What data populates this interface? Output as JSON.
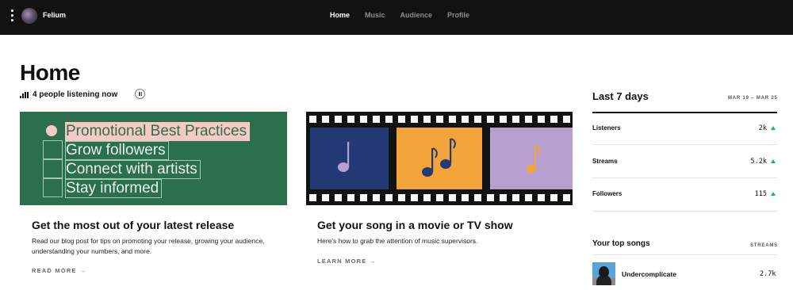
{
  "topbar": {
    "artist_name": "Felium",
    "nav": [
      {
        "label": "Home",
        "active": true
      },
      {
        "label": "Music",
        "active": false
      },
      {
        "label": "Audience",
        "active": false
      },
      {
        "label": "Profile",
        "active": false
      }
    ]
  },
  "home": {
    "title": "Home",
    "listening_text": "4 people listening now"
  },
  "cards": [
    {
      "image_lines": [
        "Promotional Best Practices",
        "Grow followers",
        "Connect with artists",
        "Stay informed"
      ],
      "title": "Get the most out of your latest release",
      "description": "Read our blog post for tips on promoting your release, growing your audience, understanding your numbers, and more.",
      "link": "READ MORE",
      "image_bg": "#2c6f4c",
      "highlight_color": "#f4c9c6"
    },
    {
      "title": "Get your song in a movie or TV show",
      "description": "Here's how to grab the attention of music supervisors.",
      "link": "LEARN MORE",
      "frame_colors": [
        "#243a77",
        "#f2a33a",
        "#b7a0d0"
      ],
      "note_colors": [
        "#b7a0d0",
        "#243a77",
        "#f2a33a"
      ]
    }
  ],
  "stats": {
    "title": "Last 7 days",
    "range": "MAR 19 – MAR 25",
    "rows": [
      {
        "label": "Listeners",
        "value": "2k"
      },
      {
        "label": "Streams",
        "value": "5.2k"
      },
      {
        "label": "Followers",
        "value": "115"
      }
    ],
    "trend_color": "#1db954"
  },
  "top_songs": {
    "title": "Your top songs",
    "column_label": "STREAMS",
    "songs": [
      {
        "name": "Undercomplicate",
        "streams": "2.7k"
      }
    ]
  }
}
